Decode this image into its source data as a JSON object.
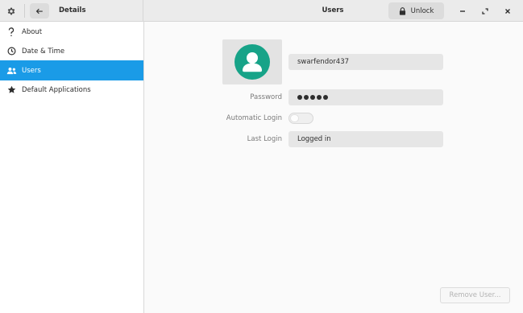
{
  "header": {
    "left_title": "Details",
    "main_title": "Users",
    "unlock_label": "Unlock"
  },
  "sidebar": {
    "items": [
      {
        "label": "About",
        "icon": "question-icon"
      },
      {
        "label": "Date & Time",
        "icon": "clock-icon"
      },
      {
        "label": "Users",
        "icon": "users-icon",
        "active": true
      },
      {
        "label": "Default Applications",
        "icon": "star-icon"
      }
    ]
  },
  "user": {
    "username": "swarfendor437",
    "password_label": "Password",
    "autologin_label": "Automatic Login",
    "autologin_enabled": false,
    "last_login_label": "Last Login",
    "last_login_value": "Logged in"
  },
  "actions": {
    "remove_user_label": "Remove User..."
  },
  "colors": {
    "accent": "#1a9be7",
    "avatar": "#17a388"
  }
}
